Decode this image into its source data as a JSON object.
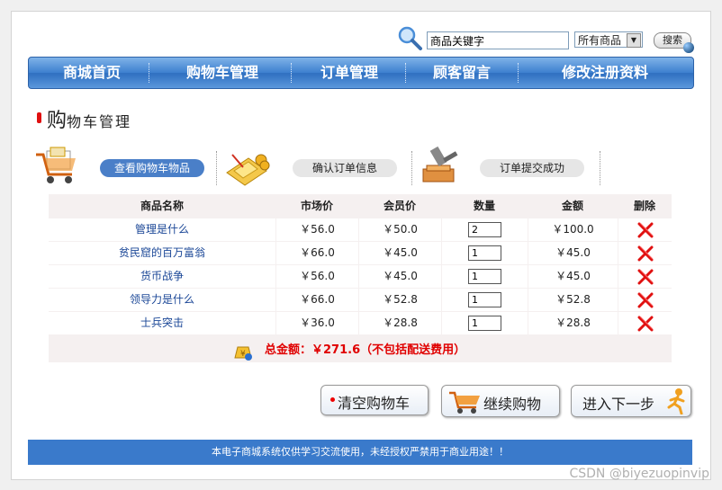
{
  "search": {
    "input_value": "商品关键字",
    "category": "所有商品",
    "button": "搜索"
  },
  "nav": [
    "商城首页",
    "购物车管理",
    "订单管理",
    "顾客留言",
    "修改注册资料"
  ],
  "page_title": {
    "big": "购",
    "rest": "物车管理"
  },
  "steps": [
    "查看购物车物品",
    "确认订单信息",
    "订单提交成功"
  ],
  "table": {
    "headers": [
      "商品名称",
      "市场价",
      "会员价",
      "数量",
      "金额",
      "删除"
    ],
    "rows": [
      {
        "name": "管理是什么",
        "market": "￥56.0",
        "member": "￥50.0",
        "qty": "2",
        "amount": "￥100.0"
      },
      {
        "name": "贫民窟的百万富翁",
        "market": "￥66.0",
        "member": "￥45.0",
        "qty": "1",
        "amount": "￥45.0"
      },
      {
        "name": "货币战争",
        "market": "￥56.0",
        "member": "￥45.0",
        "qty": "1",
        "amount": "￥45.0"
      },
      {
        "name": "领导力是什么",
        "market": "￥66.0",
        "member": "￥52.8",
        "qty": "1",
        "amount": "￥52.8"
      },
      {
        "name": "士兵突击",
        "market": "￥36.0",
        "member": "￥28.8",
        "qty": "1",
        "amount": "￥28.8"
      }
    ]
  },
  "total": "总金额：￥271.6（不包括配送费用）",
  "buttons": {
    "clear": "清空购物车",
    "continue": "继续购物",
    "next": "进入下一步"
  },
  "footer": "本电子商城系统仅供学习交流使用，未经授权严禁用于商业用途！！",
  "watermark": "CSDN @biyezuopinvip"
}
